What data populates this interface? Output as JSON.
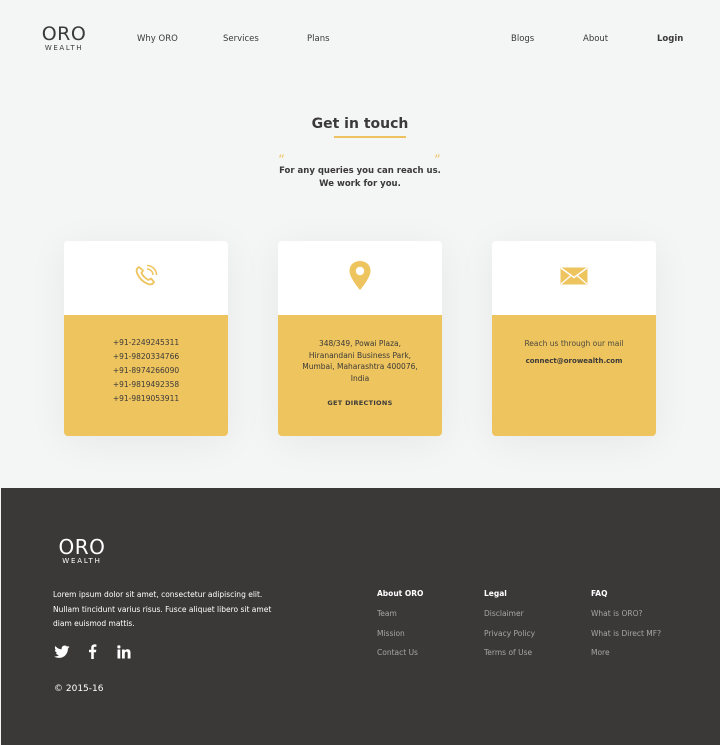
{
  "brand": {
    "name": "ORO",
    "tagline": "WEALTH"
  },
  "nav": {
    "why": "Why ORO",
    "services": "Services",
    "plans": "Plans",
    "blogs": "Blogs",
    "about": "About",
    "login": "Login"
  },
  "contact": {
    "title": "Get in touch",
    "open_quote": "“",
    "close_quote": "”",
    "subtitle_line1": "For any queries you can reach us.",
    "subtitle_line2": "We work for you.",
    "phone_card": {
      "icon": "phone-icon",
      "numbers": [
        "+91-2249245311",
        "+91-9820334766",
        "+91-8974266090",
        "+91-9819492358",
        "+91-9819053911"
      ]
    },
    "address_card": {
      "icon": "location-pin-icon",
      "address": "348/349, Powai Plaza, Hiranandani Business Park, Mumbai, Maharashtra 400076, India",
      "directions_label": "GET DIRECTIONS"
    },
    "mail_card": {
      "icon": "mail-icon",
      "text": "Reach us through our mail",
      "email": "connect@orowealth.com"
    }
  },
  "footer": {
    "description": "Lorem ipsum dolor sit amet, consectetur adipiscing elit. Nullam tincidunt varius risus. Fusce aliquet libero sit amet diam euismod mattis.",
    "copyright": "© 2015-16",
    "socials": [
      "twitter-icon",
      "facebook-icon",
      "linkedin-icon"
    ],
    "columns": [
      {
        "heading": "About ORO",
        "links": [
          "Team",
          "Mission",
          "Contact Us"
        ]
      },
      {
        "heading": "Legal",
        "links": [
          "Disclaimer",
          "Privacy Policy",
          "Terms of Use"
        ]
      },
      {
        "heading": "FAQ",
        "links": [
          "What is ORO?",
          "What is Direct MF?",
          "More"
        ]
      }
    ]
  },
  "colors": {
    "accent": "#edc45e",
    "text": "#3b3939",
    "footer_bg": "#3b3838",
    "page_bg": "#f4f5f5"
  }
}
